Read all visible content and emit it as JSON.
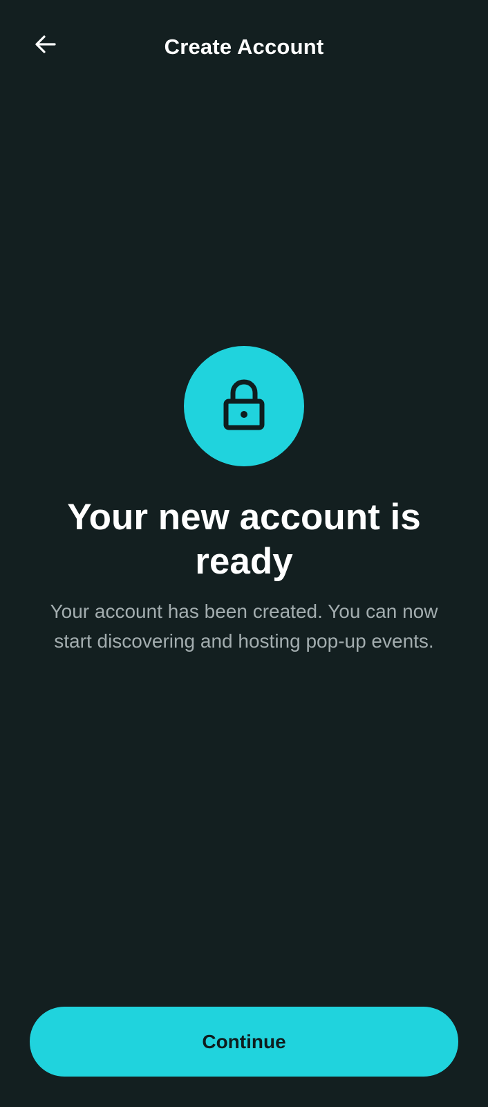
{
  "header": {
    "title": "Create Account",
    "back_icon": "arrow-left-icon"
  },
  "hero": {
    "icon": "lock-icon",
    "headline": "Your new account is ready",
    "message": "Your account has been created. You can now start discovering and hosting pop-up events."
  },
  "actions": {
    "continue_label": "Continue"
  },
  "colors": {
    "background": "#131f20",
    "accent": "#20d3dd",
    "text_primary": "#ffffff",
    "text_secondary": "#a3adaf",
    "button_text": "#0f1d1e"
  }
}
